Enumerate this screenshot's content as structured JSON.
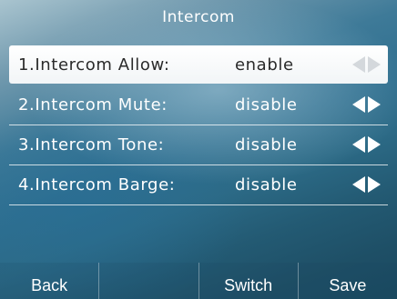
{
  "screen": {
    "title": "Intercom"
  },
  "options": [
    {
      "label": "1.Intercom Allow:",
      "value": "enable",
      "selected": true
    },
    {
      "label": "2.Intercom Mute:",
      "value": "disable",
      "selected": false
    },
    {
      "label": "3.Intercom Tone:",
      "value": "disable",
      "selected": false
    },
    {
      "label": "4.Intercom Barge:",
      "value": "disable",
      "selected": false
    }
  ],
  "softkeys": [
    "Back",
    "",
    "Switch",
    "Save"
  ],
  "icons": {
    "prev": "arrow-left-icon",
    "next": "arrow-right-icon"
  },
  "colors": {
    "text": "#ffffff",
    "selected_bg": "#ffffff",
    "selected_text": "#2a2a2a"
  }
}
